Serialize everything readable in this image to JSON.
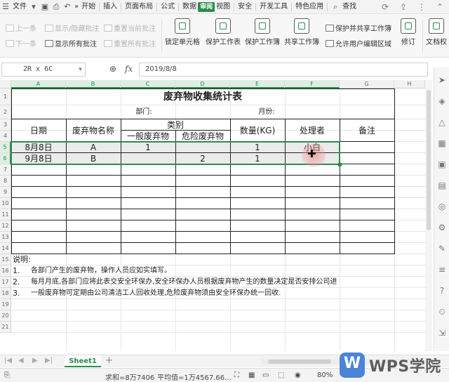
{
  "menubar": {
    "file": "文件",
    "more": "»",
    "tabs": [
      "开始",
      "插入",
      "页面布局",
      "公式",
      "数据",
      "审阅",
      "视图",
      "安全",
      "开发工具",
      "特色应用"
    ],
    "active_tab": "审阅",
    "search": "查找"
  },
  "ribbon": {
    "prev": "上一条",
    "next": "下一条",
    "show_hide_comment": "显示/隐藏批注",
    "show_all_comments": "显示所有批注",
    "reset_current_comment": "重置当前批注",
    "reset_all_comments": "重置所有批注",
    "lock_cell": "锁定单元格",
    "protect_sheet": "保护工作表",
    "protect_workbook": "保护工作簿",
    "share_workbook": "共享工作簿",
    "protect_share_workbook": "保护并共享工作簿",
    "allow_edit_ranges": "允许用户编辑区域",
    "revise": "修订",
    "doc_rights": "文档权"
  },
  "formula": {
    "namebox": "2R x 6C",
    "fx": "fx",
    "value": "2019/8/8"
  },
  "grid": {
    "col_headers": [
      "A",
      "B",
      "C",
      "D",
      "E",
      "F",
      "G",
      "H"
    ],
    "row_headers": [
      "1",
      "2",
      "3",
      "4",
      "5",
      "6",
      "7",
      "8",
      "9",
      "10",
      "11",
      "12",
      "13",
      "14",
      "15",
      "16",
      "17",
      "18",
      "19",
      "20",
      "21"
    ],
    "title": "废弃物收集统计表",
    "dept_label": "部门:",
    "month_label": "月份:",
    "headers": {
      "date": "日期",
      "waste_name": "废弃物名称",
      "category": "类别",
      "general": "一般废弃物",
      "hazardous": "危险废弃物",
      "quantity": "数量(KG)",
      "handler": "处理者",
      "remark": "备注"
    },
    "rows": [
      {
        "date": "8月8日",
        "name": "A",
        "general": "1",
        "hazardous": "",
        "qty": "1",
        "handler": "小白",
        "remark": ""
      },
      {
        "date": "9月8日",
        "name": "B",
        "general": "",
        "hazardous": "2",
        "qty": "1",
        "handler": "",
        "remark": ""
      }
    ],
    "notes_title": "说明:",
    "notes": [
      {
        "num": "1.",
        "text": "各部门产生的废弃物，操作人员应如实填写。"
      },
      {
        "num": "2.",
        "text": "每月月底,各部门应将此表交安全环保办,安全环保办人员根据废弃物产生的数量决定是否安排公司进"
      },
      {
        "num": "3.",
        "text": "一般废弃物可定期由公司清洁工人回收处理,危险废弃物须由安全环保办统一回收."
      }
    ]
  },
  "tabs": {
    "sheet": "Sheet1",
    "add": "+"
  },
  "status": {
    "sum": "求和=8万7406",
    "avg": "平均值=1万4567.66...",
    "zoom": "80%"
  },
  "watermark": {
    "text": "WPS学院"
  },
  "colors": {
    "accent": "#2a8d4b",
    "selection_fill": "#ebebeb",
    "watermark_blue": "#3e7bd6"
  }
}
